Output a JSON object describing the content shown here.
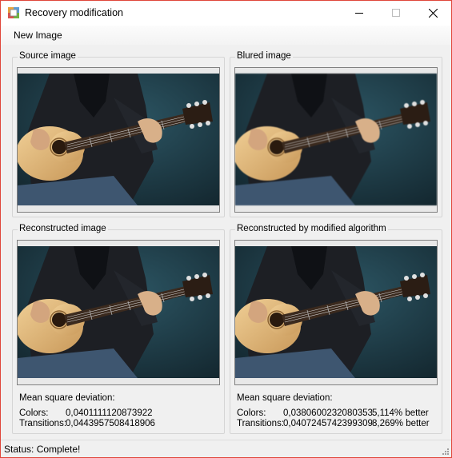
{
  "window": {
    "title": "Recovery modification"
  },
  "menu": {
    "items": [
      "New Image"
    ]
  },
  "panels": {
    "source": {
      "title": "Source image"
    },
    "blured": {
      "title": "Blured image"
    },
    "reconstructed": {
      "title": "Reconstructed image",
      "stats_heading": "Mean square deviation:",
      "colors_label": "Colors:",
      "colors_value": "0,0401111120873922",
      "transitions_label": "Transitions:",
      "transitions_value": "0,0443957508418906"
    },
    "modified": {
      "title": "Reconstructed by modified algorithm",
      "stats_heading": "Mean square deviation:",
      "colors_label": "Colors:",
      "colors_value": "0,0380600232080353",
      "colors_better": "5,114% better",
      "transitions_label": "Transitions:",
      "transitions_value": "0,0407245742399309",
      "transitions_better": "8,269% better"
    }
  },
  "status": {
    "text": "Status: Complete!"
  },
  "colors": {
    "window_border": "#e0463a",
    "background": "#f0f0f0",
    "photo_bg": "#1c3a45"
  }
}
